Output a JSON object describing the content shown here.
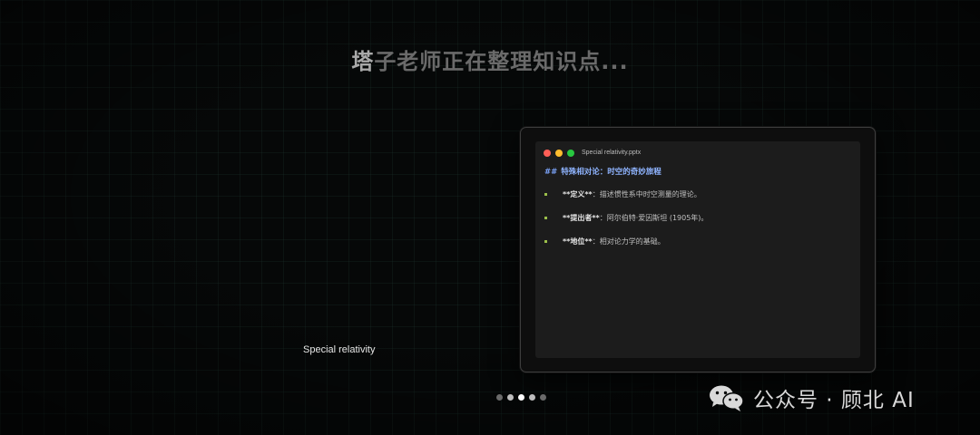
{
  "headline": {
    "lead_char": "塔",
    "rest": "子老师正在整理知识点..."
  },
  "editor": {
    "file_name": "Special relativity.pptx",
    "heading_hash": "##",
    "heading_text": "特殊相对论：时空的奇妙旅程",
    "bullets": [
      {
        "key": "**定义**",
        "value": "：描述惯性系中时空测量的理论。"
      },
      {
        "key": "**提出者**",
        "value": "：阿尔伯特·爱因斯坦 (1905年)。"
      },
      {
        "key": "**地位**",
        "value": "：相对论力学的基础。"
      }
    ]
  },
  "caption": "Special relativity",
  "pager": {
    "count": 5,
    "active_index": 2
  },
  "watermark": {
    "icon": "wechat-icon",
    "text": "公众号 · 顾北 AI"
  },
  "colors": {
    "bullet_marker": "#9bbf4a",
    "heading": "#8fb4ff",
    "window_close": "#ff5f57",
    "window_minimize": "#febc2e",
    "window_maximize": "#28c840"
  }
}
